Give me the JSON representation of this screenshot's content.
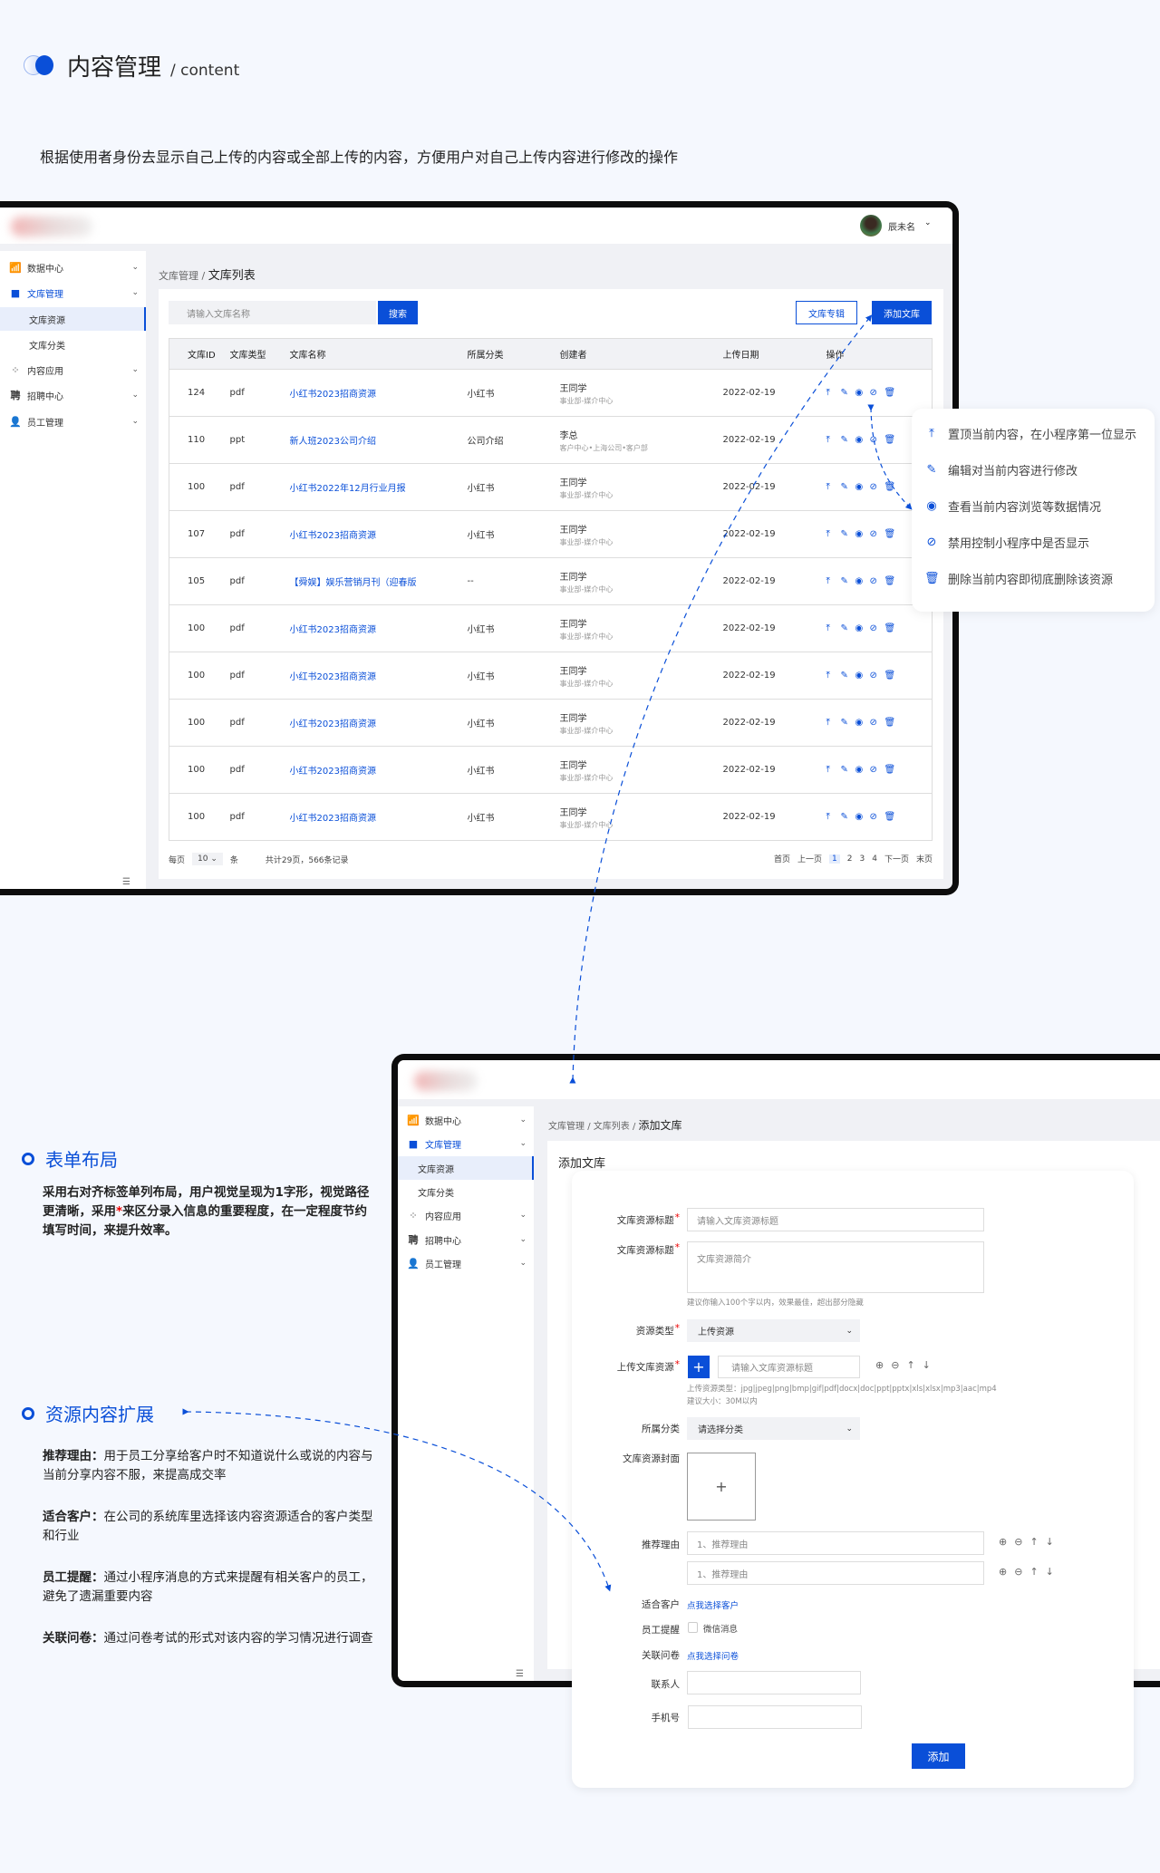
{
  "page": {
    "title": "内容管理",
    "subtitle": "/ content",
    "description": "根据使用者身份去显示自己上传的内容或全部上传的内容，方便用户对自己上传内容进行修改的操作"
  },
  "colors": {
    "accent": "#0a4fd8",
    "background": "#f5f8fe",
    "required": "#e00000"
  },
  "user": {
    "name": "辰未名"
  },
  "sidebar": {
    "items": [
      {
        "label": "数据中心",
        "icon": "chart-icon"
      },
      {
        "label": "文库管理",
        "icon": "folder-icon"
      },
      {
        "label": "文库资源"
      },
      {
        "label": "文库分类"
      },
      {
        "label": "内容应用",
        "icon": "apps-icon"
      },
      {
        "label": "招聘中心",
        "icon": "recruit-icon"
      },
      {
        "label": "员工管理",
        "icon": "user-icon"
      }
    ],
    "collapse_icon": "menu-collapse-icon"
  },
  "list": {
    "breadcrumb": {
      "parent": "文库管理",
      "sep": "/",
      "current": "文库列表"
    },
    "search": {
      "placeholder": "请输入文库名称",
      "button": "搜索"
    },
    "buttons": {
      "album": "文库专辑",
      "add": "添加文库"
    },
    "columns": [
      "文库ID",
      "文库类型",
      "文库名称",
      "所属分类",
      "创建者",
      "上传日期",
      "操作"
    ],
    "rows": [
      {
        "id": "124",
        "type": "pdf",
        "name": "小红书2023招商资源",
        "category": "小红书",
        "creator": "王同学",
        "dept": "事业部-媒介中心",
        "date": "2022-02-19"
      },
      {
        "id": "110",
        "type": "ppt",
        "name": "新人班2023公司介绍",
        "category": "公司介绍",
        "creator": "李总",
        "dept": "客户中心•上海公司•客户部",
        "date": "2022-02-19"
      },
      {
        "id": "100",
        "type": "pdf",
        "name": "小红书2022年12月行业月报",
        "category": "小红书",
        "creator": "王同学",
        "dept": "事业部-媒介中心",
        "date": "2022-02-19"
      },
      {
        "id": "107",
        "type": "pdf",
        "name": "小红书2023招商资源",
        "category": "小红书",
        "creator": "王同学",
        "dept": "事业部-媒介中心",
        "date": "2022-02-19"
      },
      {
        "id": "105",
        "type": "pdf",
        "name": "【舜娱】娱乐营销月刊（迎春版",
        "category": "--",
        "creator": "王同学",
        "dept": "事业部-媒介中心",
        "date": "2022-02-19"
      },
      {
        "id": "100",
        "type": "pdf",
        "name": "小红书2023招商资源",
        "category": "小红书",
        "creator": "王同学",
        "dept": "事业部-媒介中心",
        "date": "2022-02-19"
      },
      {
        "id": "100",
        "type": "pdf",
        "name": "小红书2023招商资源",
        "category": "小红书",
        "creator": "王同学",
        "dept": "事业部-媒介中心",
        "date": "2022-02-19"
      },
      {
        "id": "100",
        "type": "pdf",
        "name": "小红书2023招商资源",
        "category": "小红书",
        "creator": "王同学",
        "dept": "事业部-媒介中心",
        "date": "2022-02-19"
      },
      {
        "id": "100",
        "type": "pdf",
        "name": "小红书2023招商资源",
        "category": "小红书",
        "creator": "王同学",
        "dept": "事业部-媒介中心",
        "date": "2022-02-19"
      },
      {
        "id": "100",
        "type": "pdf",
        "name": "小红书2023招商资源",
        "category": "小红书",
        "creator": "王同学",
        "dept": "事业部-媒介中心",
        "date": "2022-02-19"
      }
    ],
    "actions": [
      {
        "icon": "pin-top-icon",
        "glyph": "⤒"
      },
      {
        "icon": "edit-icon",
        "glyph": "✎"
      },
      {
        "icon": "eye-icon",
        "glyph": "◉"
      },
      {
        "icon": "disable-icon",
        "glyph": "⊘"
      },
      {
        "icon": "trash-icon",
        "glyph": "🗑"
      }
    ],
    "pagination": {
      "per_page_label": "每页",
      "per_page": "10",
      "unit": "条",
      "summary": "共计29页，566条记录",
      "first": "首页",
      "prev": "上一页",
      "pages": [
        "1",
        "2",
        "3",
        "4"
      ],
      "current": "1",
      "next": "下一页",
      "last": "末页"
    }
  },
  "tooltip": [
    {
      "icon": "pin-top-icon",
      "glyph": "⤒",
      "text": "置顶当前内容，在小程序第一位显示"
    },
    {
      "icon": "edit-icon",
      "glyph": "✎",
      "text": "编辑对当前内容进行修改"
    },
    {
      "icon": "eye-icon",
      "glyph": "◉",
      "text": "查看当前内容浏览等数据情况"
    },
    {
      "icon": "disable-icon",
      "glyph": "⊘",
      "text": "禁用控制小程序中是否显示"
    },
    {
      "icon": "trash-icon",
      "glyph": "🗑",
      "text": "删除当前内容即彻底删除该资源"
    }
  ],
  "annotations": {
    "form_layout": {
      "title": "表单布局",
      "text_a": "采用右对齐标签单列布局，用户视觉呈现为1字形，视觉路径更清晰，采用",
      "star": "*",
      "text_b": "来区分录入信息的重要程度，在一定程度节约填写时间，来提升效率。"
    },
    "extension": {
      "title": "资源内容扩展",
      "items": [
        {
          "term": "推荐理由：",
          "text": "用于员工分享给客户时不知道说什么或说的内容与当前分享内容不服，来提高成交率"
        },
        {
          "term": "适合客户：",
          "text": "在公司的系统库里选择该内容资源适合的客户类型和行业"
        },
        {
          "term": "员工提醒：",
          "text": "通过小程序消息的方式来提醒有相关客户的员工，避免了遗漏重要内容"
        },
        {
          "term": "关联问卷：",
          "text": "通过问卷考试的形式对该内容的学习情况进行调查"
        }
      ]
    }
  },
  "add": {
    "breadcrumb": {
      "a": "文库管理",
      "b": "文库列表",
      "current": "添加文库",
      "sep": "/"
    },
    "heading": "添加文库",
    "fields": {
      "title_label": "文库资源标题",
      "title_placeholder": "请输入文库资源标题",
      "intro_label": "文库资源标题",
      "intro_placeholder": "文库资源简介",
      "intro_hint": "建议你输入100个字以内，效果最佳，超出部分隐藏",
      "type_label": "资源类型",
      "type_value": "上传资源",
      "upload_label": "上传文库资源",
      "upload_placeholder": "请输入文库资源标题",
      "upload_hint1": "上传资源类型：jpg|jpeg|png|bmp|gif|pdf|docx|doc|ppt|pptx|xls|xlsx|mp3|aac|mp4",
      "upload_hint2": "建议大小：30M以内",
      "category_label": "所属分类",
      "category_placeholder": "请选择分类",
      "cover_label": "文库资源封面",
      "reason_label": "推荐理由",
      "reason_placeholder": "1、推荐理由",
      "customer_label": "适合客户",
      "customer_link": "点我选择客户",
      "remind_label": "员工提醒",
      "remind_option": "微信消息",
      "survey_label": "关联问卷",
      "survey_link": "点我选择问卷",
      "contact_label": "联系人",
      "phone_label": "手机号",
      "submit": "添加"
    }
  }
}
